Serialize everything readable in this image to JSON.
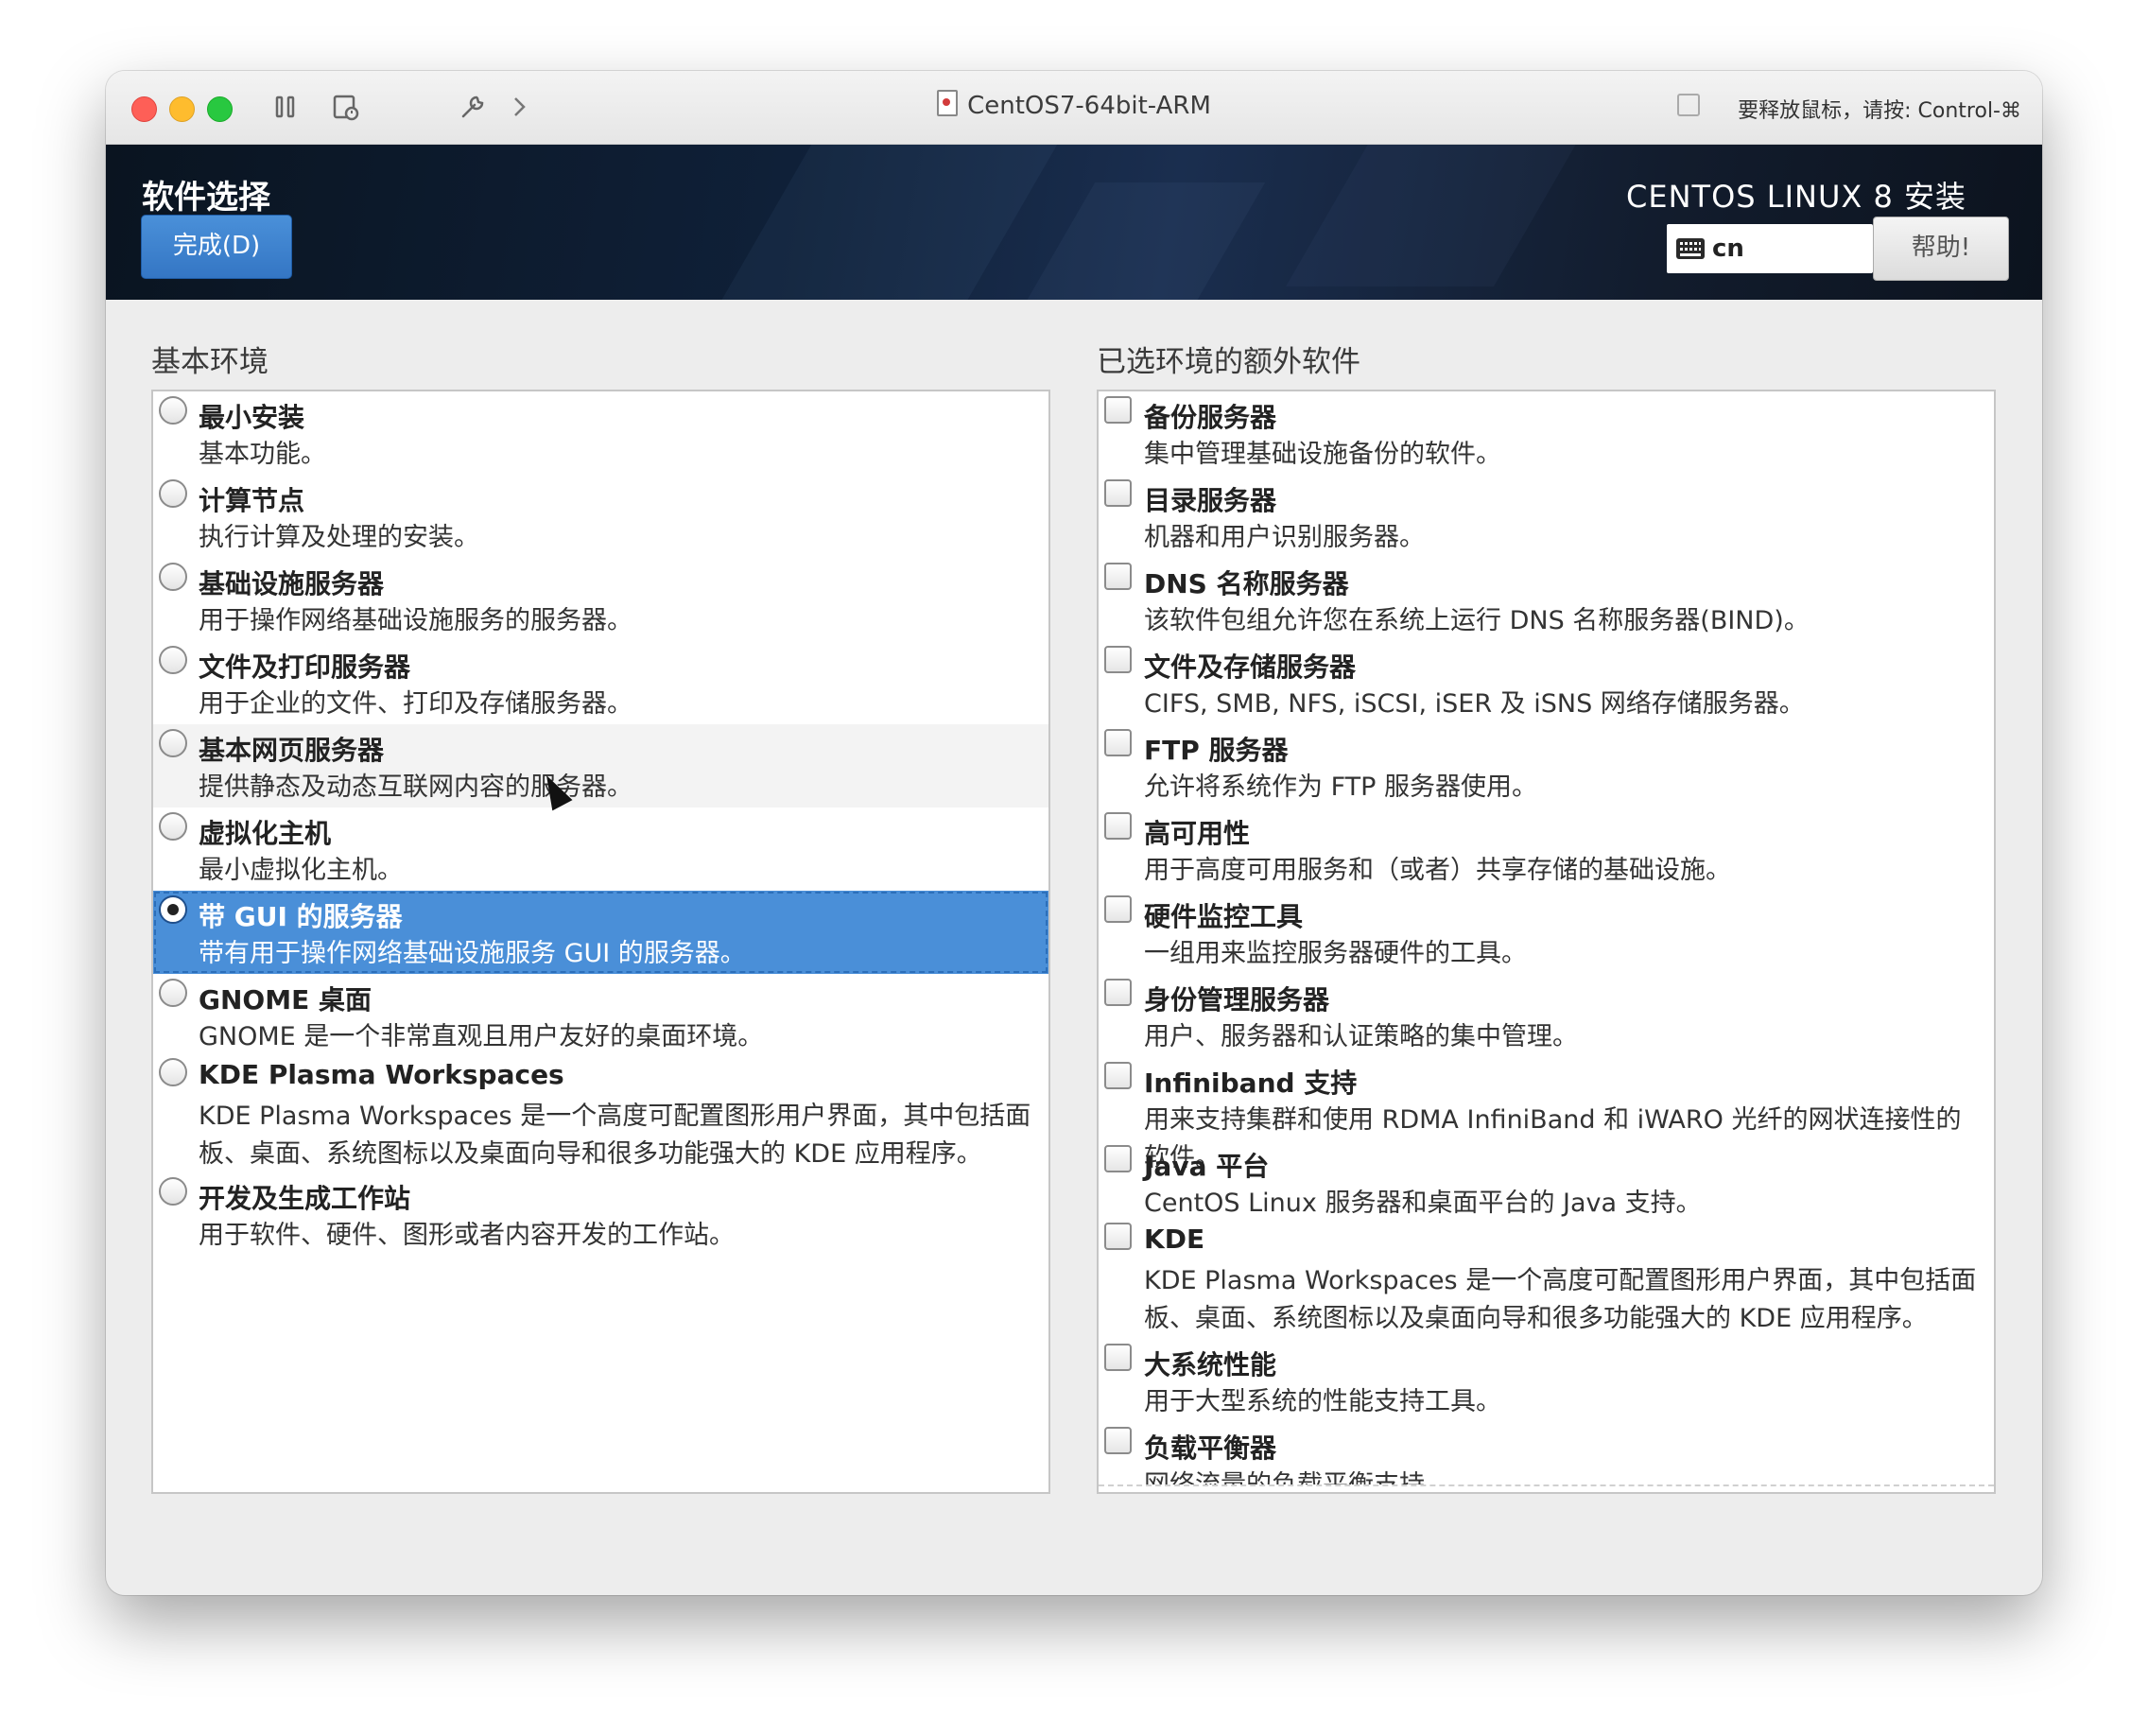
{
  "titlebar": {
    "title": "CentOS7-64bit-ARM",
    "release_hint": "要释放鼠标，请按: Control-⌘"
  },
  "header": {
    "spoke_title": "软件选择",
    "done_label": "完成(D)",
    "product": "CENTOS LINUX 8 安装",
    "keyboard_layout": "cn",
    "help_label": "帮助!"
  },
  "base_env": {
    "label": "基本环境",
    "items": [
      {
        "name": "最小安装",
        "desc": "基本功能。"
      },
      {
        "name": "计算节点",
        "desc": "执行计算及处理的安装。"
      },
      {
        "name": "基础设施服务器",
        "desc": "用于操作网络基础设施服务的服务器。"
      },
      {
        "name": "文件及打印服务器",
        "desc": "用于企业的文件、打印及存储服务器。"
      },
      {
        "name": "基本网页服务器",
        "desc": "提供静态及动态互联网内容的服务器。"
      },
      {
        "name": "虚拟化主机",
        "desc": "最小虚拟化主机。"
      },
      {
        "name": "带 GUI 的服务器",
        "desc": "带有用于操作网络基础设施服务 GUI 的服务器。"
      },
      {
        "name": "GNOME 桌面",
        "desc": "GNOME 是一个非常直观且用户友好的桌面环境。"
      },
      {
        "name": "KDE Plasma Workspaces",
        "desc": "KDE Plasma Workspaces 是一个高度可配置图形用户界面，其中包括面板、桌面、系统图标以及桌面向导和很多功能强大的 KDE 应用程序。"
      },
      {
        "name": "开发及生成工作站",
        "desc": "用于软件、硬件、图形或者内容开发的工作站。"
      }
    ],
    "selected_index": 6
  },
  "addons": {
    "label": "已选环境的额外软件",
    "items": [
      {
        "name": "备份服务器",
        "desc": "集中管理基础设施备份的软件。"
      },
      {
        "name": "目录服务器",
        "desc": "机器和用户识别服务器。"
      },
      {
        "name": "DNS 名称服务器",
        "desc": "该软件包组允许您在系统上运行 DNS 名称服务器(BIND)。"
      },
      {
        "name": "文件及存储服务器",
        "desc": "CIFS, SMB, NFS, iSCSI, iSER 及 iSNS 网络存储服务器。"
      },
      {
        "name": "FTP 服务器",
        "desc": "允许将系统作为 FTP 服务器使用。"
      },
      {
        "name": "高可用性",
        "desc": "用于高度可用服务和（或者）共享存储的基础设施。"
      },
      {
        "name": "硬件监控工具",
        "desc": "一组用来监控服务器硬件的工具。"
      },
      {
        "name": "身份管理服务器",
        "desc": "用户、服务器和认证策略的集中管理。"
      },
      {
        "name": "Infiniband 支持",
        "desc": "用来支持集群和使用 RDMA InfiniBand 和 iWARO 光纤的网状连接性的软件。"
      },
      {
        "name": "Java 平台",
        "desc": "CentOS Linux 服务器和桌面平台的 Java 支持。"
      },
      {
        "name": "KDE",
        "desc": "KDE Plasma Workspaces 是一个高度可配置图形用户界面，其中包括面板、桌面、系统图标以及桌面向导和很多功能强大的 KDE 应用程序。"
      },
      {
        "name": "大系统性能",
        "desc": "用于大型系统的性能支持工具。"
      },
      {
        "name": "负载平衡器",
        "desc": "网络流量的负载平衡支持。"
      }
    ]
  }
}
